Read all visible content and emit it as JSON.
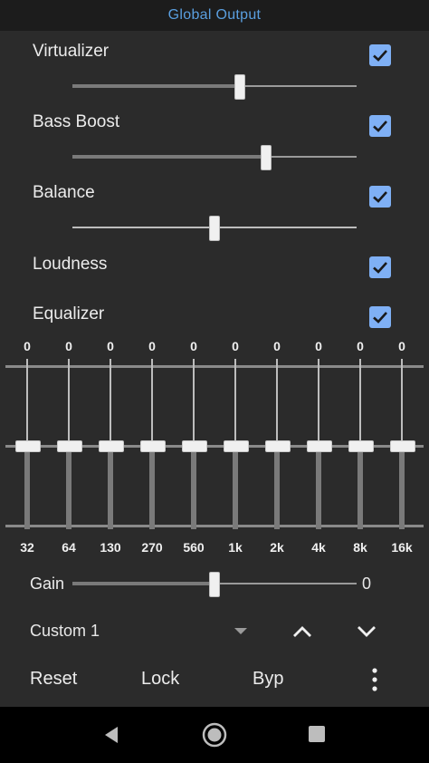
{
  "title": "Global Output",
  "toggles": [
    {
      "label": "Virtualizer",
      "checked": true,
      "slider_value": 0.59
    },
    {
      "label": "Bass Boost",
      "checked": true,
      "slider_value": 0.68
    },
    {
      "label": "Balance",
      "checked": true,
      "slider_value": 0.5
    },
    {
      "label": "Loudness",
      "checked": true
    },
    {
      "label": "Equalizer",
      "checked": true
    }
  ],
  "equalizer": {
    "bands": [
      {
        "value": "0",
        "freq": "32"
      },
      {
        "value": "0",
        "freq": "64"
      },
      {
        "value": "0",
        "freq": "130"
      },
      {
        "value": "0",
        "freq": "270"
      },
      {
        "value": "0",
        "freq": "560"
      },
      {
        "value": "0",
        "freq": "1k"
      },
      {
        "value": "0",
        "freq": "2k"
      },
      {
        "value": "0",
        "freq": "4k"
      },
      {
        "value": "0",
        "freq": "8k"
      },
      {
        "value": "0",
        "freq": "16k"
      }
    ]
  },
  "gain": {
    "label": "Gain",
    "value": "0",
    "slider_value": 0.5
  },
  "preset": {
    "selected": "Custom 1"
  },
  "actions": {
    "reset": "Reset",
    "lock": "Lock",
    "bypass": "Byp"
  },
  "icons": {
    "check": "check-icon",
    "up": "chevron-up-icon",
    "down": "chevron-down-icon",
    "more": "more-vertical-icon",
    "back": "nav-back-icon",
    "home": "nav-home-icon",
    "recents": "nav-recents-icon"
  },
  "colors": {
    "accent": "#5a9fe0",
    "checkbox": "#7fb0f5",
    "background": "#2b2b2b"
  }
}
